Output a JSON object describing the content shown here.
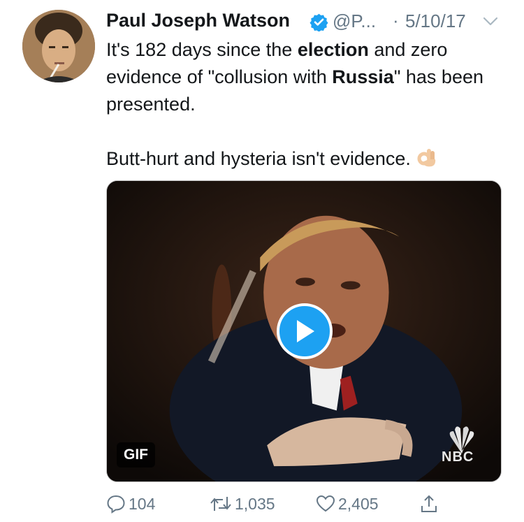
{
  "tweet": {
    "author_name": "Paul Joseph Watson",
    "handle": "@P...",
    "separator": "·",
    "date": "5/10/17",
    "text": {
      "p1_a": "It's 182 days since the ",
      "p1_b": "election",
      "p1_c": " and zero evidence of \"collusion with ",
      "p1_d": "Russia",
      "p1_e": "\" has been presented.",
      "p2": "Butt-hurt and hysteria isn't evidence."
    },
    "emoji": "ok-hand-emoji"
  },
  "media": {
    "badge": "GIF",
    "watermark": "NBC",
    "play_icon": "play-icon"
  },
  "actions": {
    "reply_count": "104",
    "retweet_count": "1,035",
    "like_count": "2,405"
  },
  "colors": {
    "text": "#14171a",
    "secondary": "#657786",
    "accent": "#1da1f2"
  }
}
